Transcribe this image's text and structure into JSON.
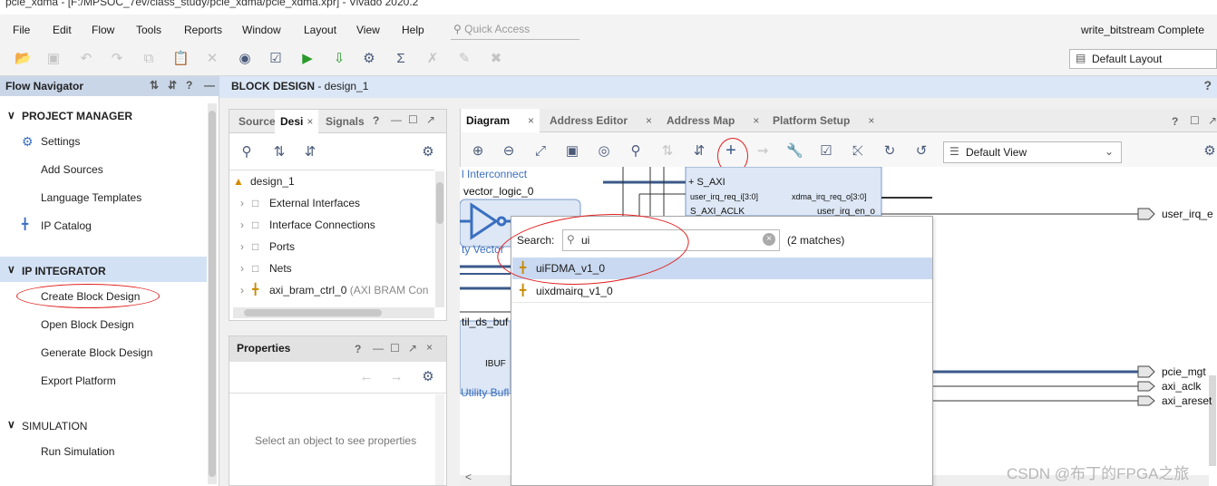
{
  "window": {
    "title": "pcie_xdma - [F:/MPSOC_7ev/class_study/pcie_xdma/pcie_xdma.xpr] - Vivado 2020.2"
  },
  "menu": [
    "File",
    "Edit",
    "Flow",
    "Tools",
    "Reports",
    "Window",
    "Layout",
    "View",
    "Help"
  ],
  "quick_access": {
    "placeholder": "Quick Access"
  },
  "status": "write_bitstream Complete",
  "layout_dropdown": {
    "selected": "Default Layout"
  },
  "flow_navigator": {
    "title": "Flow Navigator",
    "sections": [
      {
        "label": "PROJECT MANAGER",
        "items": [
          "Settings",
          "Add Sources",
          "Language Templates",
          "IP Catalog"
        ]
      },
      {
        "label": "IP INTEGRATOR",
        "items": [
          "Create Block Design",
          "Open Block Design",
          "Generate Block Design",
          "Export Platform"
        ]
      },
      {
        "label": "SIMULATION",
        "items": [
          "Run Simulation"
        ]
      }
    ]
  },
  "block_design": {
    "title_prefix": "BLOCK DESIGN",
    "title_suffix": " - design_1"
  },
  "sources_panel": {
    "tabs": [
      "Source",
      "Desi",
      "Signals"
    ],
    "root": "design_1",
    "items": [
      "External Interfaces",
      "Interface Connections",
      "Ports",
      "Nets",
      "axi_bram_ctrl_0"
    ],
    "item_detail": "(AXI BRAM Con"
  },
  "properties_panel": {
    "title": "Properties",
    "empty_text": "Select an object to see properties"
  },
  "diagram": {
    "tabs": [
      "Diagram",
      "Address Editor",
      "Address Map",
      "Platform Setup"
    ],
    "view_dropdown": "Default View",
    "fragments": {
      "interconnect": "l Interconnect",
      "vector_logic": "vector_logic_0",
      "utility_vector": "ty Vector",
      "util_ds_buf": "til_ds_buf",
      "ibuf": "IBUF",
      "utility_buf": "Utility Bufl",
      "s_axi": "S_AXI",
      "user_irq_req": "user_irq_req_i[3:0]",
      "xdma_irq_req": "xdma_irq_req_o[3:0]",
      "s_axi_aclk": "S_AXI_ACLK",
      "user_irq_en": "user_irq_en_o"
    },
    "ports": [
      "user_irq_e",
      "pcie_mgt",
      "axi_aclk",
      "axi_areset"
    ]
  },
  "search_popup": {
    "label": "Search:",
    "value": "ui",
    "match_count": "(2 matches)",
    "results": [
      "uiFDMA_v1_0",
      "uixdmairq_v1_0"
    ]
  },
  "watermark": "CSDN @布丁的FPGA之旅",
  "colors": {
    "selection": "#c9d9f1",
    "annotation": "#e02020",
    "header": "#dbe7f6"
  }
}
